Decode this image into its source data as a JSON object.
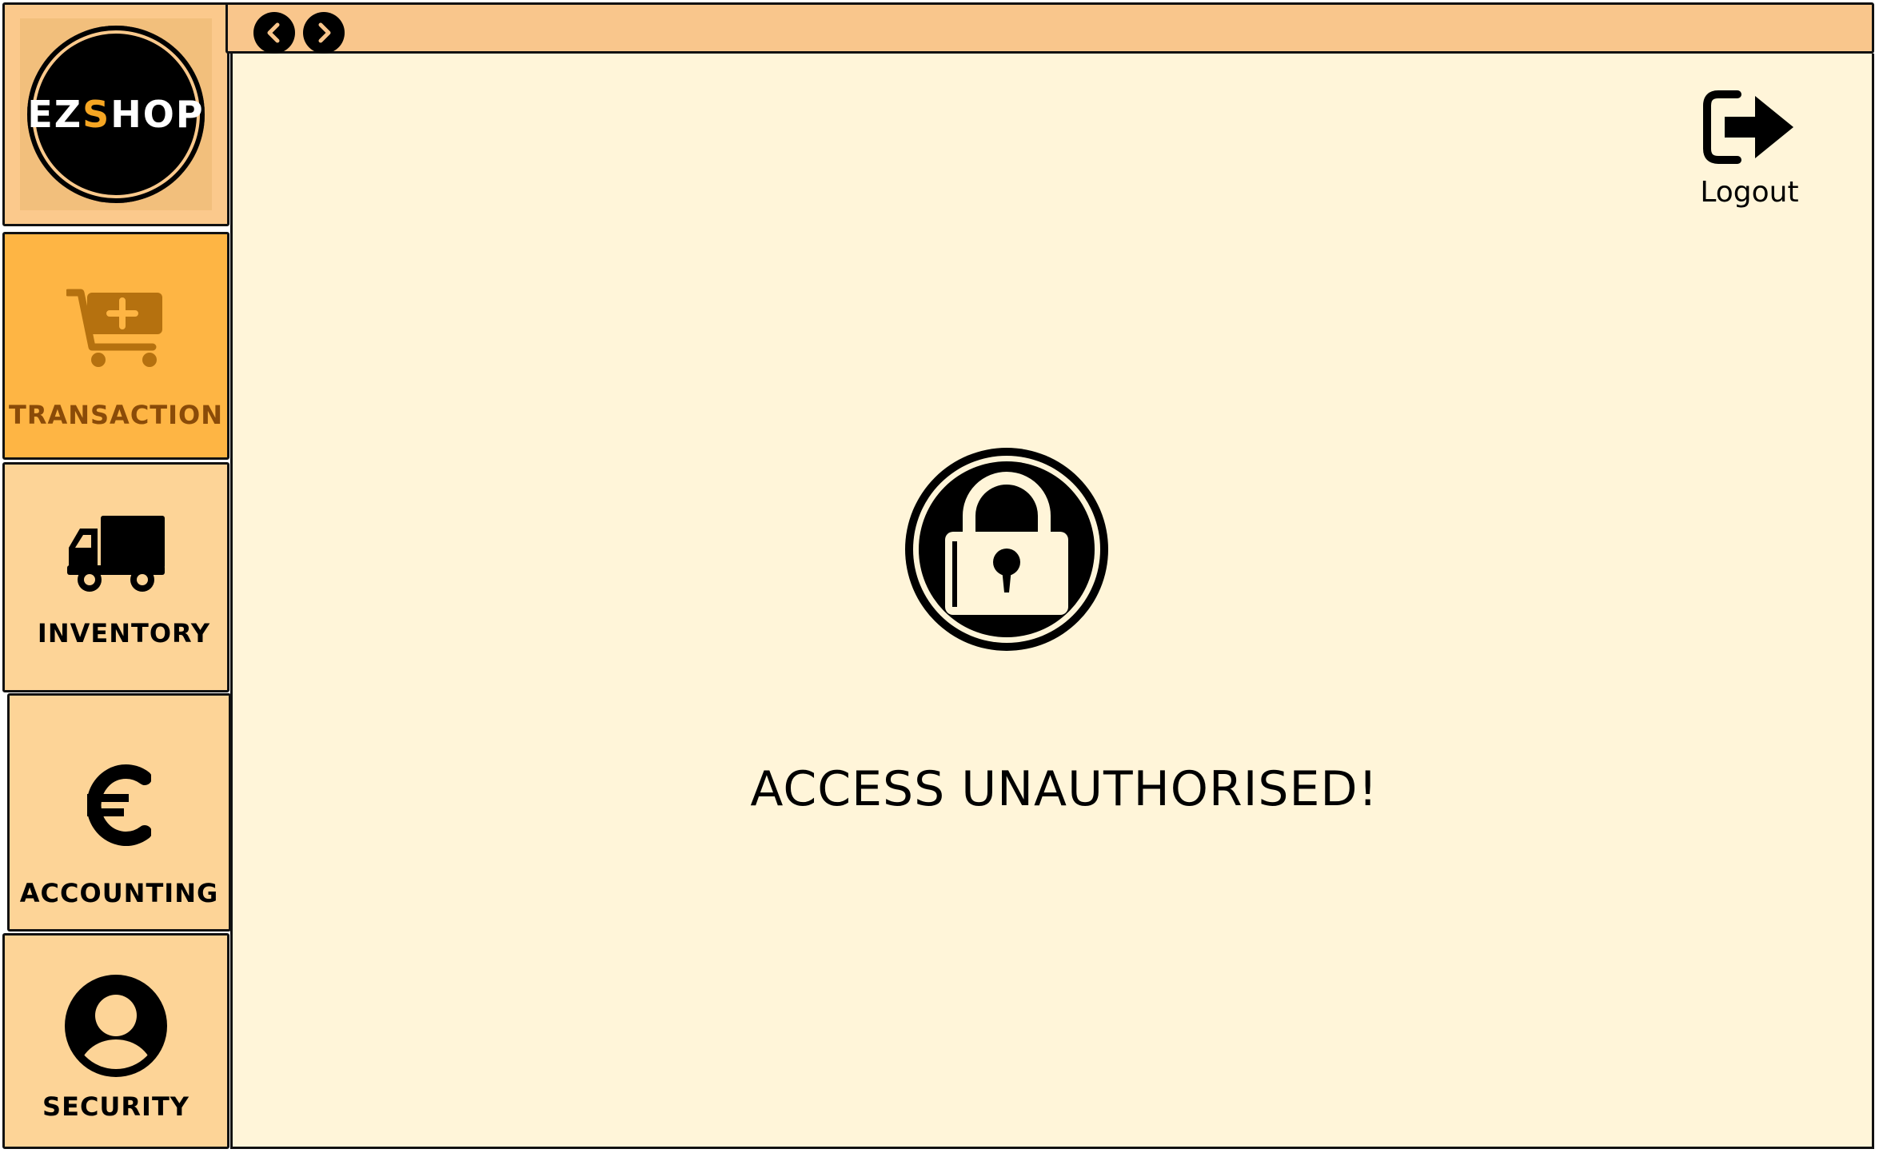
{
  "brand": {
    "logo_prefix": "EZ",
    "logo_accent": "S",
    "logo_suffix": "HOP",
    "accent_color": "#f6a623"
  },
  "sidebar": {
    "items": [
      {
        "label": "TRANSACTION",
        "icon": "cart-add-icon",
        "active": true
      },
      {
        "label": "INVENTORY",
        "icon": "truck-icon",
        "active": false
      },
      {
        "label": "ACCOUNTING",
        "icon": "euro-icon",
        "active": false
      },
      {
        "label": "SECURITY",
        "icon": "user-icon",
        "active": false
      }
    ]
  },
  "topbar": {
    "back_icon": "chevron-left-icon",
    "forward_icon": "chevron-right-icon"
  },
  "header": {
    "logout_label": "Logout",
    "logout_icon": "logout-icon"
  },
  "main": {
    "icon": "lock-icon",
    "message": "ACCESS UNAUTHORISED!"
  },
  "colors": {
    "sidebar_bg": "#fdd497",
    "active_item_bg": "#feb544",
    "topbar_bg": "#f9c68c",
    "main_bg": "#fff5d9"
  }
}
